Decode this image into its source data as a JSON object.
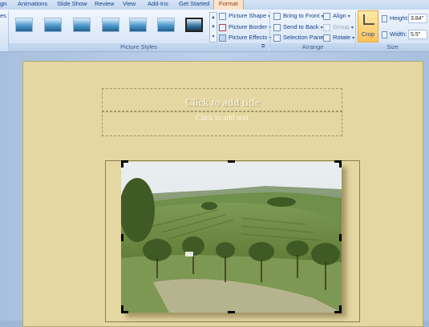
{
  "tabs": [
    {
      "label": "gn"
    },
    {
      "label": "Animations"
    },
    {
      "label": "Slide Show"
    },
    {
      "label": "Review"
    },
    {
      "label": "View"
    },
    {
      "label": "Add-Ins"
    },
    {
      "label": "Get Started"
    },
    {
      "label": "Format",
      "active": true
    }
  ],
  "ribbon": {
    "left_fragment": "es",
    "picture_styles": {
      "label": "Picture Styles",
      "shape": "Picture Shape",
      "border": "Picture Border",
      "effects": "Picture Effects"
    },
    "arrange": {
      "label": "Arrange",
      "bring_front": "Bring to Front",
      "send_back": "Send to Back",
      "selection_pane": "Selection Pane",
      "align": "Align",
      "group": "Group",
      "rotate": "Rotate"
    },
    "size": {
      "label": "Size",
      "crop": "Crop",
      "height_label": "Height:",
      "height_value": "3.84\"",
      "width_label": "Width:",
      "width_value": "5.5\""
    }
  },
  "slide": {
    "title_placeholder": "Click to add title",
    "text_placeholder": "Click to add text"
  },
  "colors": {
    "accent_tab": "#fce3c9",
    "slide_bg": "#e4d7a2",
    "ribbon_bg": "#dfeaf8"
  }
}
